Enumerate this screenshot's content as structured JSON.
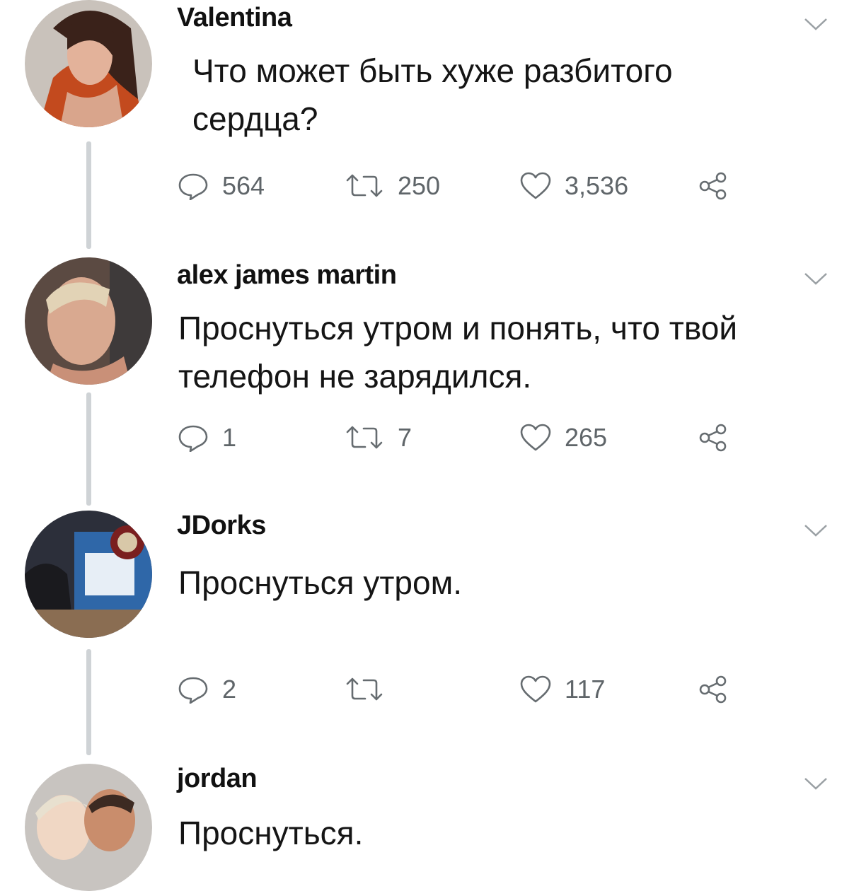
{
  "tweets": [
    {
      "author": "Valentina",
      "text_lines": [
        "Что может быть хуже разбитого",
        "сердца?"
      ],
      "actions": {
        "replies": "564",
        "retweets": "250",
        "likes": "3,536"
      }
    },
    {
      "author": "alex james martin",
      "text_lines": [
        "Проснуться утром и понять, что твой",
        "телефон не зарядился."
      ],
      "actions": {
        "replies": "1",
        "retweets": "7",
        "likes": "265"
      }
    },
    {
      "author": "JDorks",
      "text_lines": [
        "Проснуться утром."
      ],
      "actions": {
        "replies": "2",
        "retweets": "",
        "likes": "117"
      }
    },
    {
      "author": "jordan",
      "text_lines": [
        "Проснуться."
      ]
    }
  ],
  "icons": {
    "reply": "reply-icon",
    "retweet": "retweet-icon",
    "like": "heart-icon",
    "share": "share-icon",
    "menu": "chevron-down-icon"
  },
  "colors": {
    "action_gray": "#666c70",
    "thread_line": "#cfd3d6"
  }
}
